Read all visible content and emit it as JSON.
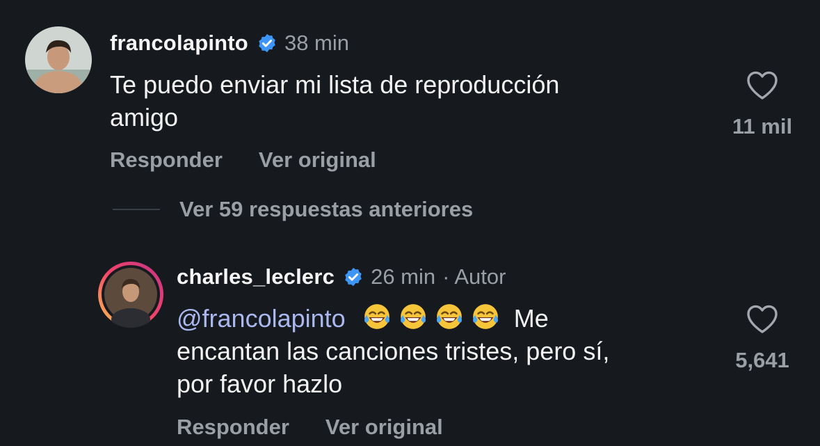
{
  "comments": [
    {
      "username": "francolapinto",
      "time": "38 min",
      "meta_extra": "",
      "text_line1": "Te puedo enviar mi lista de reproducción",
      "text_line2": "amigo",
      "likes": "11 mil",
      "reply_label": "Responder",
      "original_label": "Ver original"
    },
    {
      "username": "charles_leclerc",
      "time": "26 min",
      "meta_extra": "· Autor",
      "mention": "@francolapinto",
      "emoji": "😂😂😂😂",
      "text_line1_end": "Me",
      "text_line2": "encantan las canciones tristes, pero sí,",
      "text_line3": "por favor hazlo",
      "likes": "5,641",
      "reply_label": "Responder",
      "original_label": "Ver original"
    }
  ],
  "thread": {
    "view_replies_label": "Ver 59 respuestas anteriores"
  },
  "colors": {
    "background": "#16191e",
    "secondary_text": "#9a9ea5",
    "mention": "#aab8f0",
    "verified": "#3d96f7"
  },
  "icons": {
    "verified": "verified-badge-icon",
    "like": "heart-icon",
    "emoji": "face-with-tears-of-joy"
  }
}
